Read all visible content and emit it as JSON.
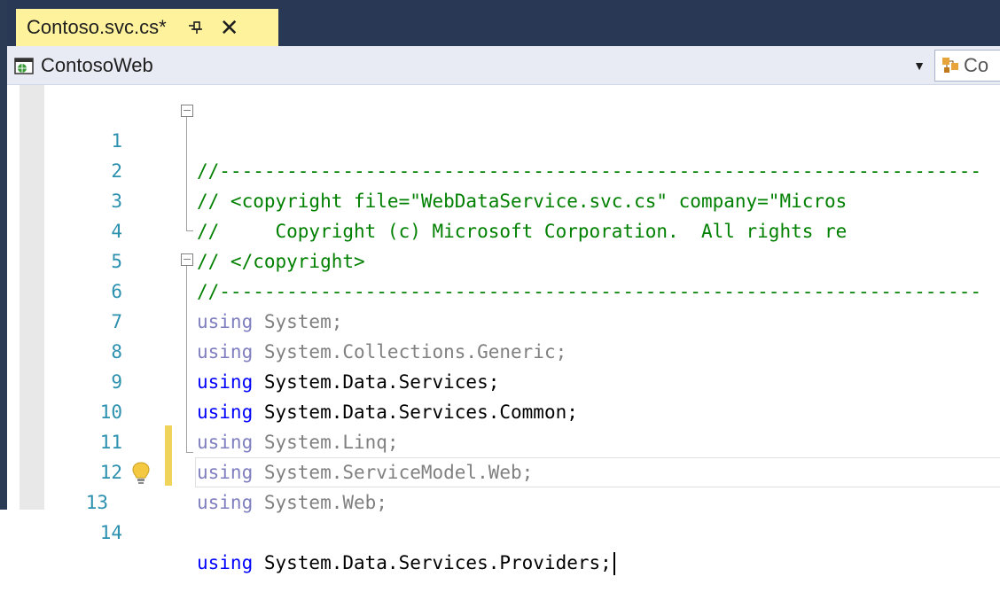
{
  "tab": {
    "title": "Contoso.svc.cs*"
  },
  "navbar": {
    "project": "ContosoWeb",
    "type_partial": "Co"
  },
  "editor": {
    "lines": [
      {
        "num": "1",
        "text": "//--------------------------------------------------------------------"
      },
      {
        "num": "2",
        "text": "// <copyright file=\"WebDataService.svc.cs\" company=\"Micros"
      },
      {
        "num": "3",
        "text": "//     Copyright (c) Microsoft Corporation.  All rights re"
      },
      {
        "num": "4",
        "text": "// </copyright>"
      },
      {
        "num": "5",
        "text": "//--------------------------------------------------------------------"
      },
      {
        "num": "6",
        "kw": "using",
        "text": " System;"
      },
      {
        "num": "7",
        "kw": "using",
        "text": " System.Collections.Generic;"
      },
      {
        "num": "8",
        "kw": "using",
        "text": " System.Data.Services;"
      },
      {
        "num": "9",
        "kw": "using",
        "text": " System.Data.Services.Common;"
      },
      {
        "num": "10",
        "kw": "using",
        "text": " System.Linq;"
      },
      {
        "num": "11",
        "kw": "using",
        "text": " System.ServiceModel.Web;"
      },
      {
        "num": "12",
        "kw": "using",
        "text": " System.Web;"
      },
      {
        "num": "13",
        "kw": "using",
        "text": " System.Data.Services.Providers;"
      },
      {
        "num": "14",
        "text": ""
      }
    ]
  },
  "colors": {
    "tab_active": "#fff29d",
    "chrome_dark": "#293955",
    "line_number": "#2b91af",
    "comment": "#008000",
    "unused_using": "#808080",
    "keyword": "#0000ff",
    "change_marker": "#efd35b"
  },
  "icons": {
    "tab_pin": "pin-icon",
    "tab_close": "close-icon",
    "project": "web-project-icon",
    "type": "class-icon",
    "lightbulb": "lightbulb-icon"
  }
}
